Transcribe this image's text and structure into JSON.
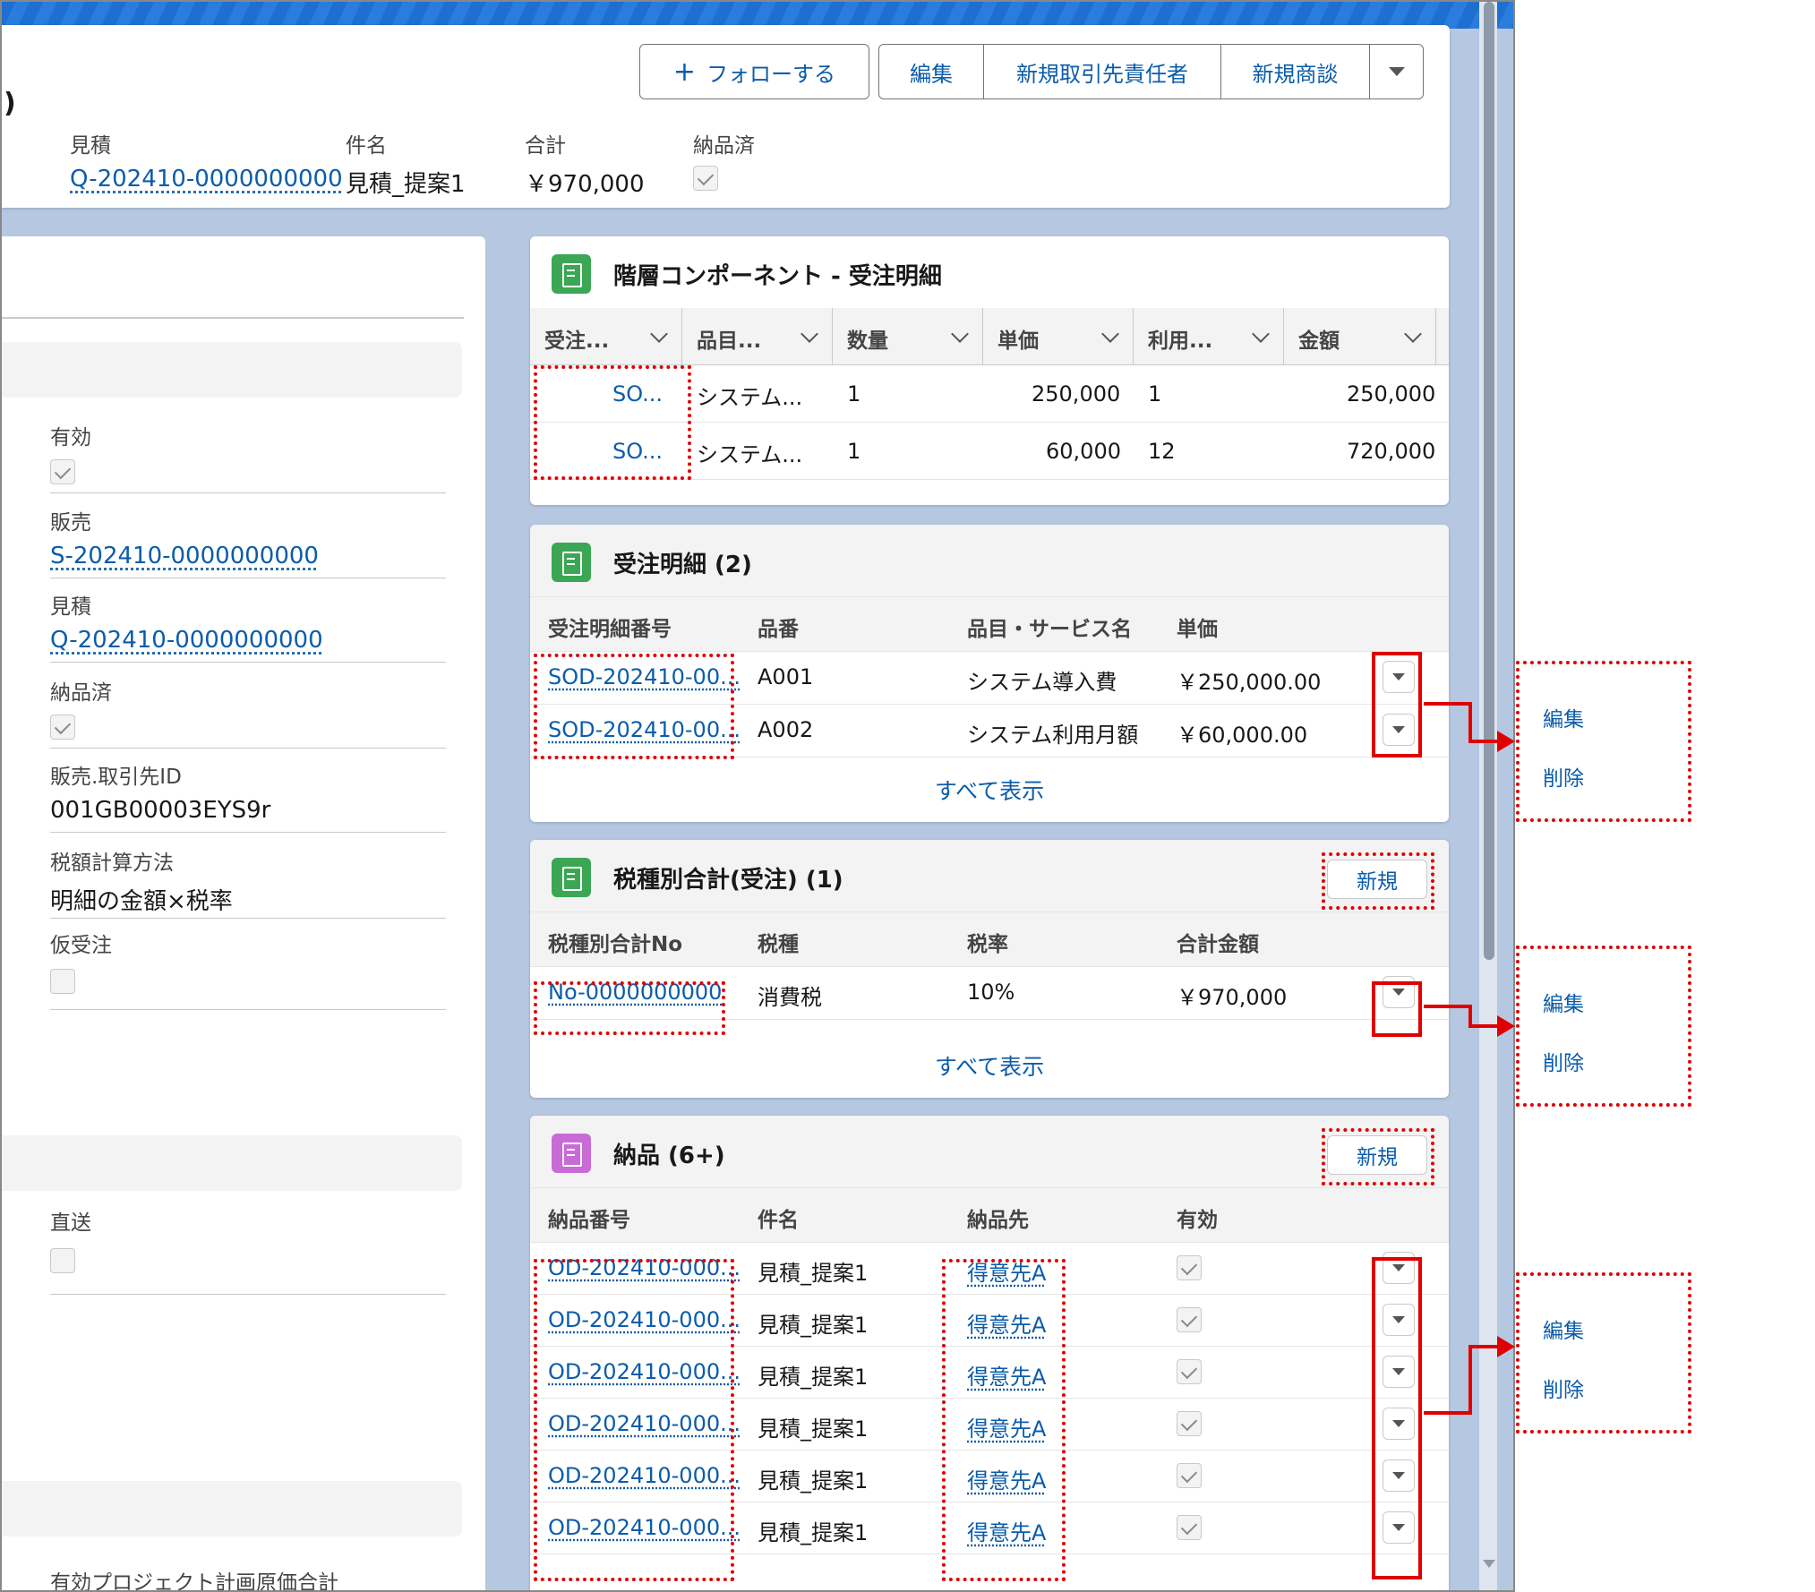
{
  "header": {
    "title_fragment": ")",
    "follow_label": "フォローする",
    "actions": [
      "編集",
      "新規取引先責任者",
      "新規商談"
    ],
    "fields": [
      {
        "label": "見積",
        "value": "Q-202410-0000000000",
        "link": true
      },
      {
        "label": "件名",
        "value": "見積_提案1"
      },
      {
        "label": "合計",
        "value": "￥970,000"
      },
      {
        "label": "納品済",
        "checked": true
      }
    ]
  },
  "left": {
    "fields": [
      {
        "label": "有効",
        "checked": true
      },
      {
        "label": "販売",
        "value": "S-202410-0000000000",
        "link": true
      },
      {
        "label": "見積",
        "value": "Q-202410-0000000000",
        "link": true
      },
      {
        "label": "納品済",
        "checked": true
      },
      {
        "label": "販売.取引先ID",
        "value": "001GB00003EYS9r"
      },
      {
        "label": "税額計算方法",
        "value": "明細の金額×税率"
      },
      {
        "label": "仮受注",
        "checked": false
      },
      {
        "label": "直送",
        "checked": false
      },
      {
        "label": "有効プロジェクト計画原価合計"
      }
    ]
  },
  "hierarchy": {
    "title": "階層コンポーネント - 受注明細",
    "columns": [
      "受注...",
      "品目...",
      "数量",
      "単価",
      "利用...",
      "金額"
    ],
    "rows": [
      [
        "SO...",
        "システム...",
        "1",
        "250,000",
        "1",
        "250,000"
      ],
      [
        "SO...",
        "システム...",
        "1",
        "60,000",
        "12",
        "720,000"
      ]
    ]
  },
  "order_lines": {
    "title": "受注明細 (2)",
    "columns": [
      "受注明細番号",
      "品番",
      "品目・サービス名",
      "単価"
    ],
    "rows": [
      [
        "SOD-202410-00...",
        "A001",
        "システム導入費",
        "￥250,000.00"
      ],
      [
        "SOD-202410-00...",
        "A002",
        "システム利用月額",
        "￥60,000.00"
      ]
    ],
    "view_all": "すべて表示"
  },
  "tax_totals": {
    "title": "税種別合計(受注) (1)",
    "new_label": "新規",
    "columns": [
      "税種別合計No",
      "税種",
      "税率",
      "合計金額"
    ],
    "rows": [
      [
        "No-0000000000",
        "消費税",
        "10%",
        "￥970,000"
      ]
    ],
    "view_all": "すべて表示"
  },
  "deliveries": {
    "title": "納品 (6+)",
    "new_label": "新規",
    "columns": [
      "納品番号",
      "件名",
      "納品先",
      "有効"
    ],
    "rows": [
      [
        "OD-202410-000...",
        "見積_提案1",
        "得意先A",
        true
      ],
      [
        "OD-202410-000...",
        "見積_提案1",
        "得意先A",
        true
      ],
      [
        "OD-202410-000...",
        "見積_提案1",
        "得意先A",
        true
      ],
      [
        "OD-202410-000...",
        "見積_提案1",
        "得意先A",
        true
      ],
      [
        "OD-202410-000...",
        "見積_提案1",
        "得意先A",
        true
      ],
      [
        "OD-202410-000...",
        "見積_提案1",
        "得意先A",
        true
      ]
    ]
  },
  "row_menu": {
    "edit": "編集",
    "delete": "削除"
  },
  "colors": {
    "link": "#0b5cab",
    "annotation": "#e00000",
    "background": "#b5c7e1"
  }
}
